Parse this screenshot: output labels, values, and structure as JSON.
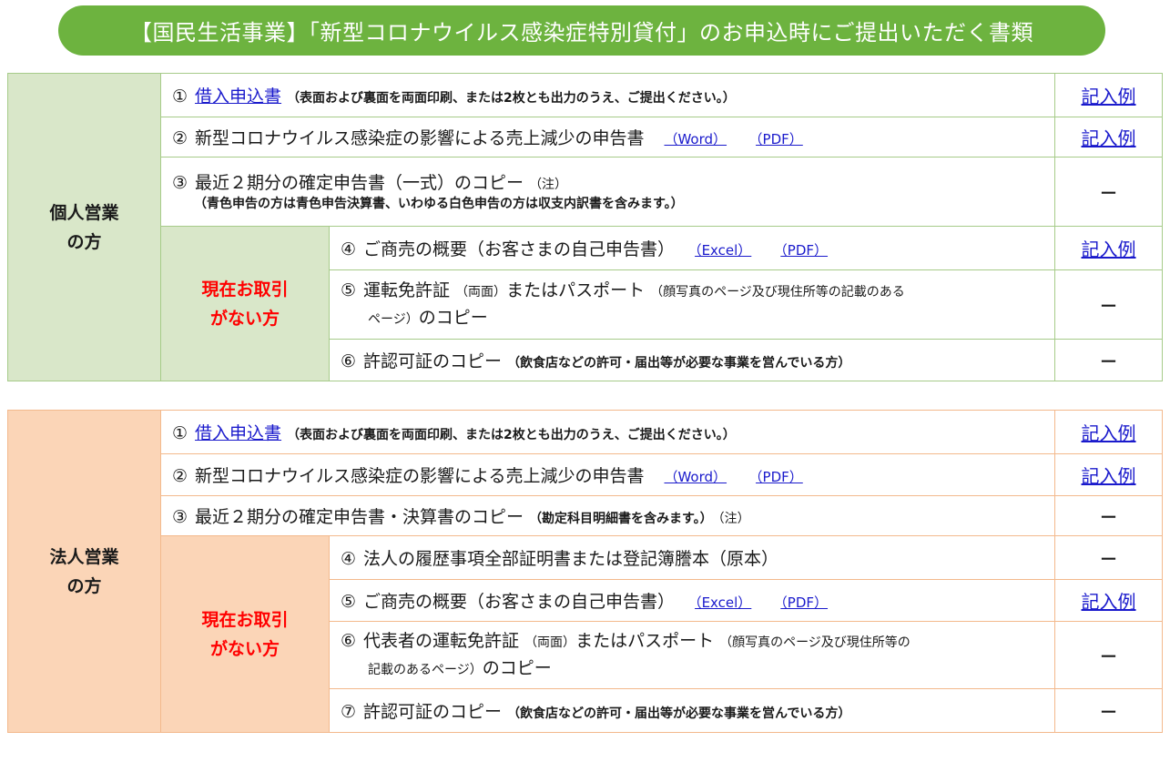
{
  "title": "【国民生活事業】「新型コロナウイルス感染症特別貸付」のお申込時にご提出いただく書類",
  "colors": {
    "banner": "#6db33f",
    "individual_bg": "#d9e7c9",
    "corporate_bg": "#fbd5b7",
    "link": "#1a1acc",
    "emphasis": "#ff0000"
  },
  "individual": {
    "category": "個人営業\nの方",
    "sub_category": "現在お取引\nがない方",
    "rows": [
      {
        "num": "①",
        "link": "借入申込書",
        "note": "（表面および裏面を両面印刷、または2枚とも出力のうえ、ご提出ください。）",
        "example": "記入例"
      },
      {
        "num": "②",
        "text": "新型コロナウイルス感染症の影響による売上減少の申告書",
        "file1": "（Word）",
        "file2": "（PDF）",
        "example": "記入例"
      },
      {
        "num": "③",
        "text": "最近２期分の確定申告書（一式）のコピー",
        "note": "（注）",
        "line2": "（青色申告の方は青色申告決算書、いわゆる白色申告の方は収支内訳書を含みます。）",
        "example": "－"
      },
      {
        "num": "④",
        "text": "ご商売の概要（お客さまの自己申告書）",
        "file1": "（Excel）",
        "file2": "（PDF）",
        "example": "記入例"
      },
      {
        "num": "⑤",
        "text": "運転免許証",
        "note1": "（両面）",
        "text2": "またはパスポート",
        "note2": "（顔写真のページ及び現住所等の記載のある",
        "line2": "ページ）",
        "text3": "のコピー",
        "example": "－"
      },
      {
        "num": "⑥",
        "text": "許認可証のコピー",
        "note": "（飲食店などの許可・届出等が必要な事業を営んでいる方）",
        "example": "－"
      }
    ]
  },
  "corporate": {
    "category": "法人営業\nの方",
    "sub_category": "現在お取引\nがない方",
    "rows": [
      {
        "num": "①",
        "link": "借入申込書",
        "note": "（表面および裏面を両面印刷、または2枚とも出力のうえ、ご提出ください。）",
        "example": "記入例"
      },
      {
        "num": "②",
        "text": "新型コロナウイルス感染症の影響による売上減少の申告書",
        "file1": "（Word）",
        "file2": "（PDF）",
        "example": "記入例"
      },
      {
        "num": "③",
        "text": "最近２期分の確定申告書・決算書のコピー",
        "note": "（勘定科目明細書を含みます。）",
        "note2": "（注）",
        "example": "－"
      },
      {
        "num": "④",
        "text": "法人の履歴事項全部証明書または登記簿謄本（原本）",
        "example": "－"
      },
      {
        "num": "⑤",
        "text": "ご商売の概要（お客さまの自己申告書）",
        "file1": "（Excel）",
        "file2": "（PDF）",
        "example": "記入例"
      },
      {
        "num": "⑥",
        "text": "代表者の運転免許証",
        "note1": "（両面）",
        "text2": "またはパスポート",
        "note2": "（顔写真のページ及び現住所等の",
        "line2": "記載のあるページ）",
        "text3": "のコピー",
        "example": "－"
      },
      {
        "num": "⑦",
        "text": "許認可証のコピー",
        "note": "（飲食店などの許可・届出等が必要な事業を営んでいる方）",
        "example": "－"
      }
    ]
  }
}
